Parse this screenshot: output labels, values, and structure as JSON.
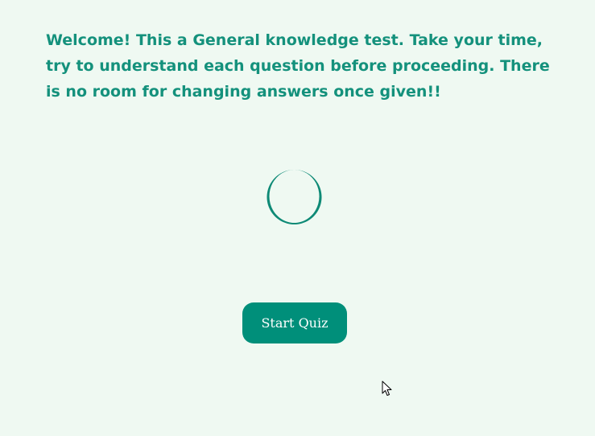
{
  "intro": {
    "welcome_text": "Welcome! This a General knowledge test. Take your time, try to understand each question before proceeding. There is no room for changing answers once given!!"
  },
  "quiz": {
    "start_label": "Start Quiz"
  },
  "icons": {
    "spinner": "loading-spinner-icon",
    "cursor": "mouse-pointer-icon"
  },
  "colors": {
    "background": "#eff9f2",
    "accent": "#008f7a",
    "text": "#14917c",
    "button_text": "#ffffff"
  }
}
